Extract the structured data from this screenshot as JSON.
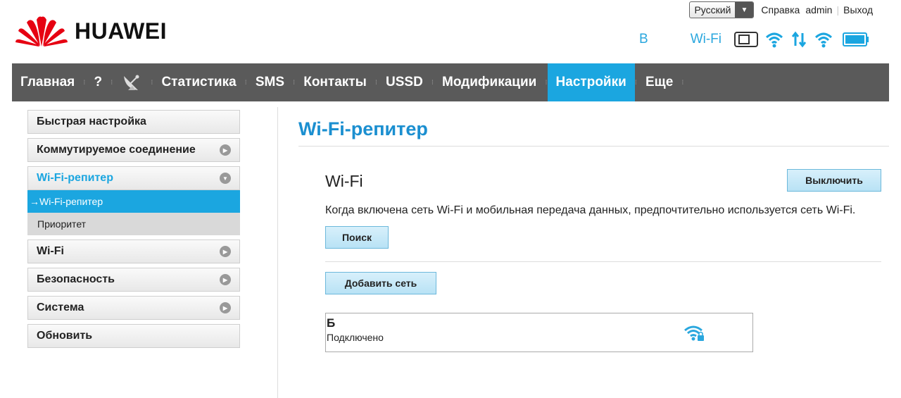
{
  "brand": {
    "name": "HUAWEI"
  },
  "topbar": {
    "language": "Русский",
    "help": "Справка",
    "user": "admin",
    "logout": "Выход"
  },
  "status": {
    "network_prefix": "B",
    "network_name": "Wi-Fi",
    "icons": [
      "sim-icon",
      "wifi-icon",
      "data-transfer-icon",
      "wifi-repeater-icon",
      "battery-icon"
    ]
  },
  "nav": {
    "items": [
      {
        "label": "Главная"
      },
      {
        "label": "?"
      },
      {
        "label": "Статистика"
      },
      {
        "label": "SMS"
      },
      {
        "label": "Контакты"
      },
      {
        "label": "USSD"
      },
      {
        "label": "Модификации"
      },
      {
        "label": "Настройки",
        "active": true
      },
      {
        "label": "Еще"
      }
    ]
  },
  "sidebar": {
    "items": [
      {
        "label": "Быстрая настройка"
      },
      {
        "label": "Коммутируемое соединение"
      },
      {
        "label": "Wi-Fi-репитер"
      },
      {
        "label": "Wi-Fi"
      },
      {
        "label": "Безопасность"
      },
      {
        "label": "Система"
      },
      {
        "label": "Обновить"
      }
    ],
    "sub_items": [
      {
        "label": "→Wi-Fi-репитер"
      },
      {
        "label": "Приоритет"
      }
    ]
  },
  "main": {
    "title": "Wi-Fi-репитер",
    "wifi_label": "Wi-Fi",
    "off_button": "Выключить",
    "description": "Когда включена сеть Wi-Fi и мобильная передача данных, предпочтительно используется сеть Wi-Fi.",
    "search_button": "Поиск",
    "add_button": "Добавить сеть",
    "network": {
      "ssid": "Б",
      "status": "Подключено"
    }
  },
  "colors": {
    "accent": "#1ba6e0",
    "nav_bg": "#5a5a5a",
    "title": "#1b8fd0",
    "brand_red": "#e60012"
  }
}
